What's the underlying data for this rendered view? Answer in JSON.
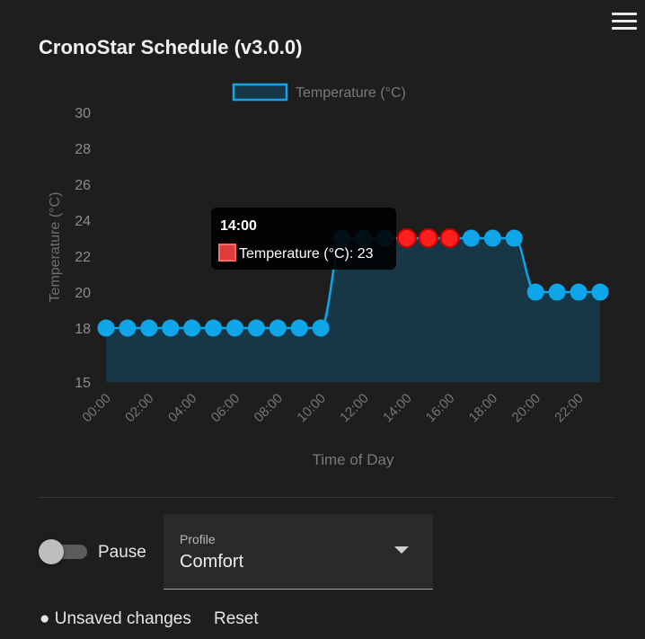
{
  "card": {
    "title": "CronoStar Schedule (v3.0.0)"
  },
  "menu": {
    "icon": "hamburger-menu-icon"
  },
  "chart_data": {
    "type": "line",
    "title": "",
    "xlabel": "Time of Day",
    "ylabel": "Temperature (°C)",
    "legend_position": "top-center",
    "grid": false,
    "ylim": [
      15,
      30
    ],
    "y_ticks": [
      15,
      18,
      20,
      22,
      24,
      26,
      28,
      30
    ],
    "x_tick_labels": [
      "00:00",
      "02:00",
      "04:00",
      "06:00",
      "08:00",
      "10:00",
      "12:00",
      "14:00",
      "16:00",
      "18:00",
      "20:00",
      "22:00"
    ],
    "categories": [
      "00:00",
      "01:00",
      "02:00",
      "03:00",
      "04:00",
      "05:00",
      "06:00",
      "07:00",
      "08:00",
      "09:00",
      "10:00",
      "11:00",
      "12:00",
      "13:00",
      "14:00",
      "15:00",
      "16:00",
      "17:00",
      "18:00",
      "19:00",
      "20:00",
      "21:00",
      "22:00",
      "23:00"
    ],
    "series": [
      {
        "name": "Temperature (°C)",
        "color": "#0ea5e9",
        "fill": "#173746",
        "values": [
          18,
          18,
          18,
          18,
          18,
          18,
          18,
          18,
          18,
          18,
          18,
          23,
          23,
          23,
          23,
          23,
          23,
          23,
          23,
          23,
          20,
          20,
          20,
          20
        ]
      }
    ],
    "highlighted_points": [
      14,
      15,
      16
    ],
    "highlight_color": "#ff1f1f",
    "tooltip": {
      "title": "14:00",
      "label": "Temperature (°C): 23"
    }
  },
  "controls": {
    "pause_label": "Pause",
    "pause_on": false,
    "profile_label": "Profile",
    "profile_value": "Comfort"
  },
  "footer": {
    "status": "● Unsaved changes",
    "reset_label": "Reset"
  }
}
